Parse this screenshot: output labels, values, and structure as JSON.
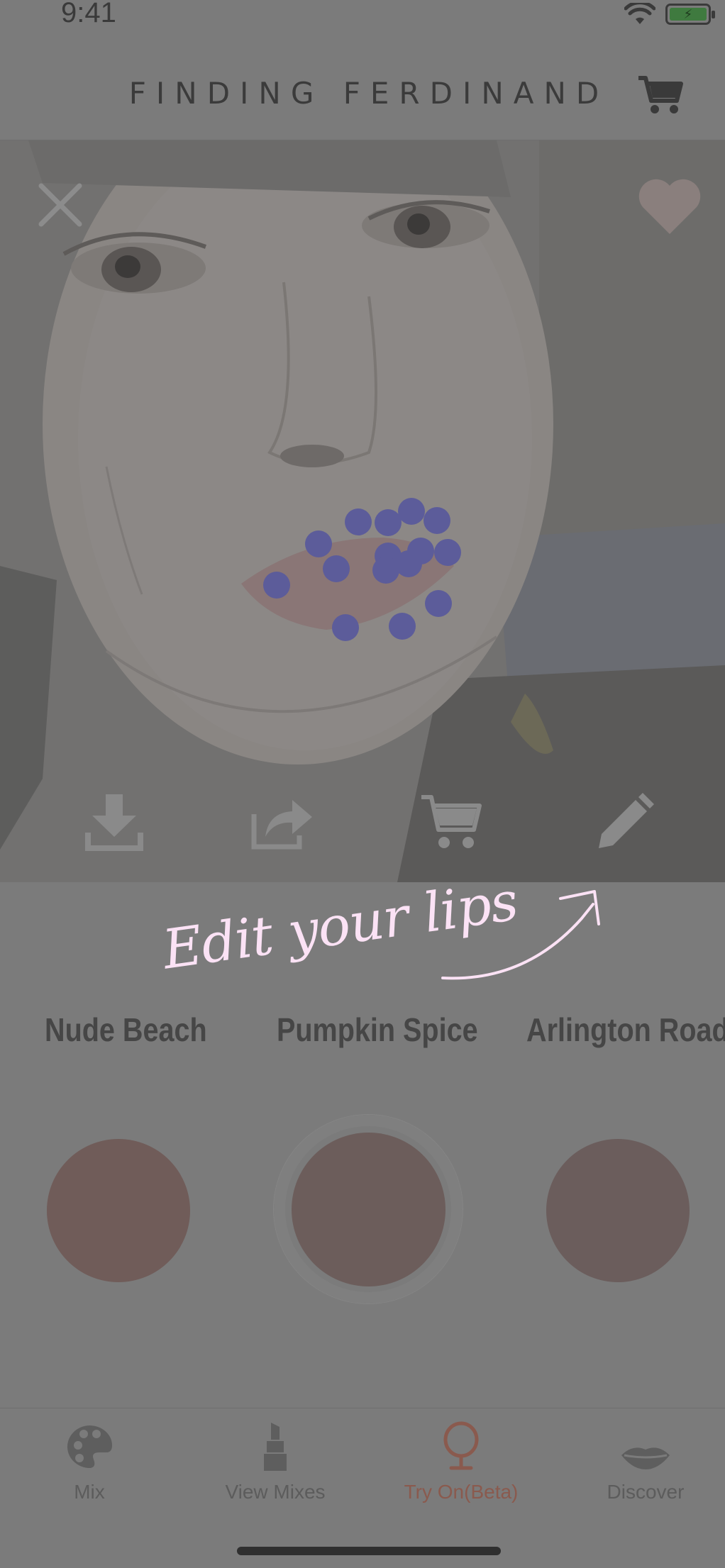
{
  "status_bar": {
    "time": "9:41"
  },
  "header": {
    "title": "FINDING FERDINAND"
  },
  "camera": {
    "tools": [
      "download-icon",
      "share-icon",
      "cart-icon",
      "pencil-icon"
    ]
  },
  "coach_mark": {
    "text": "Edit your lips"
  },
  "shades": [
    {
      "name": "Nude Beach",
      "color": "#705c59"
    },
    {
      "name": "Pumpkin Spice",
      "color": "#6c5d5b",
      "selected": true
    },
    {
      "name": "Arlington Road",
      "color": "#6b5d5c"
    }
  ],
  "tabs": [
    {
      "label": "Mix",
      "icon": "palette-icon"
    },
    {
      "label": "View Mixes",
      "icon": "lipstick-icon"
    },
    {
      "label": "Try On(Beta)",
      "icon": "mirror-icon",
      "active": true
    },
    {
      "label": "Discover",
      "icon": "lips-icon"
    }
  ],
  "colors": {
    "overlay": "#7b7b7b",
    "lip_dot": "#5c5c9a",
    "coach_text": "#fbe2f5",
    "active_tab": "#8a5a4e"
  }
}
